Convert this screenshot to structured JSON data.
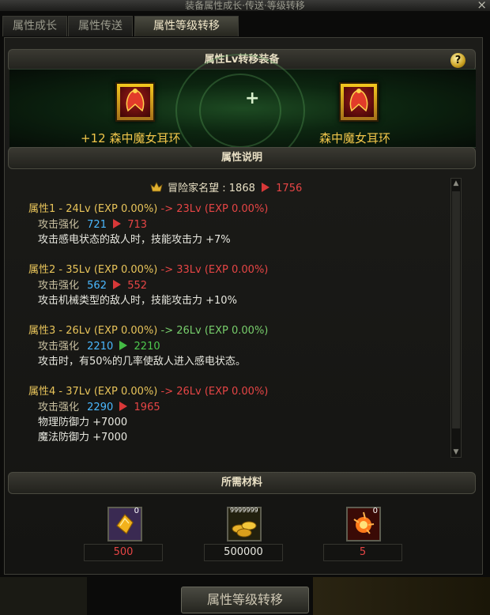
{
  "window": {
    "title": "装备属性成长·传送·等级转移",
    "close_glyph": "×"
  },
  "tabs": [
    {
      "label": "属性成长"
    },
    {
      "label": "属性传送"
    },
    {
      "label": "属性等级转移"
    }
  ],
  "transfer_header": {
    "title": "属性Lv转移装备",
    "help_glyph": "?"
  },
  "source_item": {
    "enhance": "+12",
    "name": "森中魔女耳环"
  },
  "target_item": {
    "name": "森中魔女耳环"
  },
  "plus_glyph": "+",
  "description_header": {
    "title": "属性说明"
  },
  "fame": {
    "label": "冒险家名望 : 1868",
    "new_value": "1756"
  },
  "attributes": [
    {
      "head": "属性1 - 24Lv (EXP 0.00%)",
      "arrow": "-> 23Lv (EXP 0.00%)",
      "stat_label": "攻击强化",
      "stat_old": "721",
      "stat_new": "713",
      "effect": "攻击感电状态的敌人时，技能攻击力 +7%"
    },
    {
      "head": "属性2 - 35Lv (EXP 0.00%)",
      "arrow": "-> 33Lv (EXP 0.00%)",
      "stat_label": "攻击强化",
      "stat_old": "562",
      "stat_new": "552",
      "effect": "攻击机械类型的敌人时，技能攻击力 +10%"
    },
    {
      "head": "属性3 - 26Lv (EXP 0.00%)",
      "arrow": "-> 26Lv (EXP 0.00%)",
      "stat_label": "攻击强化",
      "stat_old": "2210",
      "stat_new": "2210",
      "effect": "攻击时，有50%的几率使敌人进入感电状态。"
    },
    {
      "head": "属性4 - 37Lv (EXP 0.00%)",
      "arrow": "-> 26Lv (EXP 0.00%)",
      "stat_label": "攻击强化",
      "stat_old": "2290",
      "stat_new": "1965",
      "effect": "物理防御力 +7000",
      "effect2": "魔法防御力 +7000"
    }
  ],
  "materials_header": {
    "title": "所需材料"
  },
  "materials": [
    {
      "icon": "crystal-icon",
      "count": "0",
      "quantity": "500"
    },
    {
      "icon": "gold-coins-icon",
      "count": "9999999",
      "quantity": "500000"
    },
    {
      "icon": "energy-orb-icon",
      "count": "0",
      "quantity": "5"
    }
  ],
  "action_button": {
    "label": "属性等级转移"
  },
  "colors": {
    "gold": "#f1c64a",
    "blue": "#4ab8ff",
    "red": "#e64545",
    "green": "#4ec94e"
  }
}
